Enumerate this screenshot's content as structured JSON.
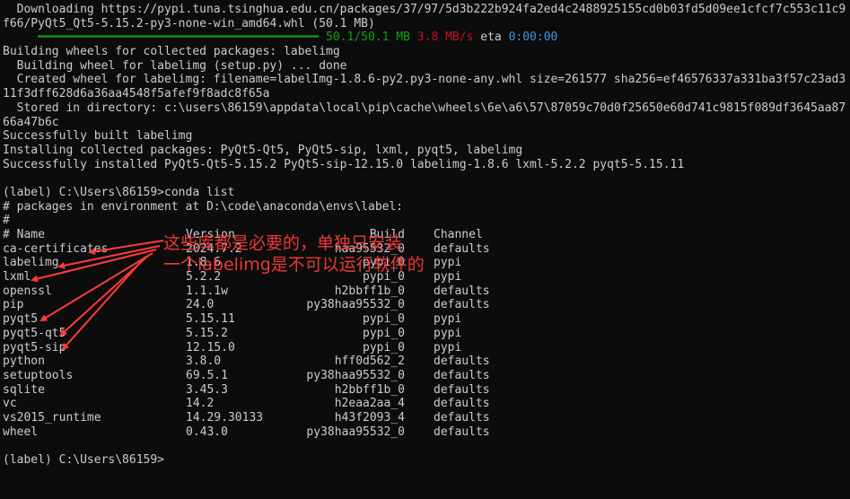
{
  "terminal": {
    "header_lines": [
      {
        "segments": [
          {
            "t": "  Downloading https://pypi.tuna.tsinghua.edu.cn/packages/37/97/5d3b222b924fa2ed4c2488925155cd0b03fd5d09ee1cfcf7c553c11c9"
          }
        ]
      },
      {
        "segments": [
          {
            "t": "f66/PyQt5_Qt5-5.15.2-py3-none-win_amd64.whl (50.1 MB)"
          }
        ]
      },
      {
        "segments": [
          {
            "t": "     ",
            "c": ""
          },
          {
            "t": "━━━━━━━━━━━━━━━━━━━━━━━━━━━━━━━━━━━━━━━━",
            "c": "seg-dashes"
          },
          {
            "t": " ",
            "c": ""
          },
          {
            "t": "50.1/50.1 MB",
            "c": "seg-green"
          },
          {
            "t": " ",
            "c": ""
          },
          {
            "t": "3.8 MB/s",
            "c": "seg-red"
          },
          {
            "t": " eta ",
            "c": ""
          },
          {
            "t": "0:00:00",
            "c": "seg-cyan"
          }
        ]
      },
      {
        "segments": [
          {
            "t": "Building wheels for collected packages: labelimg"
          }
        ]
      },
      {
        "segments": [
          {
            "t": "  Building wheel for labelimg (setup.py) ... done"
          }
        ]
      },
      {
        "segments": [
          {
            "t": "  Created wheel for labelimg: filename=labelImg-1.8.6-py2.py3-none-any.whl size=261577 sha256=ef46576337a331ba3f57c23ad3"
          }
        ]
      },
      {
        "segments": [
          {
            "t": "11f3dff628d6a36aa4548f5afef9f8adc8f65a"
          }
        ]
      },
      {
        "segments": [
          {
            "t": "  Stored in directory: c:\\users\\86159\\appdata\\local\\pip\\cache\\wheels\\6e\\a6\\57\\87059c70d0f25650e60d741c9815f089df3645aa87"
          }
        ]
      },
      {
        "segments": [
          {
            "t": "66a47b6c"
          }
        ]
      },
      {
        "segments": [
          {
            "t": "Successfully built labelimg"
          }
        ]
      },
      {
        "segments": [
          {
            "t": "Installing collected packages: PyQt5-Qt5, PyQt5-sip, lxml, pyqt5, labelimg"
          }
        ]
      },
      {
        "segments": [
          {
            "t": "Successfully installed PyQt5-Qt5-5.15.2 PyQt5-sip-12.15.0 labelimg-1.8.6 lxml-5.2.2 pyqt5-5.15.11"
          }
        ]
      },
      {
        "segments": [
          {
            "t": ""
          }
        ]
      },
      {
        "segments": [
          {
            "t": "(label) C:\\Users\\86159>conda list"
          }
        ]
      },
      {
        "segments": [
          {
            "t": "# packages in environment at D:\\code\\anaconda\\envs\\label:"
          }
        ]
      },
      {
        "segments": [
          {
            "t": "#"
          }
        ]
      }
    ],
    "table_header": {
      "name": "# Name",
      "version": "Version",
      "build": "Build",
      "channel": "Channel"
    },
    "packages": [
      {
        "name": "ca-certificates",
        "version": "2024.7.2",
        "build": "haa95532_0",
        "channel": "defaults"
      },
      {
        "name": "labelimg",
        "version": "1.8.6",
        "build": "pypi_0",
        "channel": "pypi"
      },
      {
        "name": "lxml",
        "version": "5.2.2",
        "build": "pypi_0",
        "channel": "pypi"
      },
      {
        "name": "openssl",
        "version": "1.1.1w",
        "build": "h2bbff1b_0",
        "channel": "defaults"
      },
      {
        "name": "pip",
        "version": "24.0",
        "build": "py38haa95532_0",
        "channel": "defaults"
      },
      {
        "name": "pyqt5",
        "version": "5.15.11",
        "build": "pypi_0",
        "channel": "pypi"
      },
      {
        "name": "pyqt5-qt5",
        "version": "5.15.2",
        "build": "pypi_0",
        "channel": "pypi"
      },
      {
        "name": "pyqt5-sip",
        "version": "12.15.0",
        "build": "pypi_0",
        "channel": "pypi"
      },
      {
        "name": "python",
        "version": "3.8.0",
        "build": "hff0d562_2",
        "channel": "defaults"
      },
      {
        "name": "setuptools",
        "version": "69.5.1",
        "build": "py38haa95532_0",
        "channel": "defaults"
      },
      {
        "name": "sqlite",
        "version": "3.45.3",
        "build": "h2bbff1b_0",
        "channel": "defaults"
      },
      {
        "name": "vc",
        "version": "14.2",
        "build": "h2eaa2aa_4",
        "channel": "defaults"
      },
      {
        "name": "vs2015_runtime",
        "version": "14.29.30133",
        "build": "h43f2093_4",
        "channel": "defaults"
      },
      {
        "name": "wheel",
        "version": "0.43.0",
        "build": "py38haa95532_0",
        "channel": "defaults"
      }
    ],
    "footer_blank": "",
    "prompt": "(label) C:\\Users\\86159>"
  },
  "annotation": {
    "line1": "这些库都是必要的，单独只安装",
    "line2": "一个labelimg是不可以运行软件的",
    "color": "#ff3b3b"
  },
  "colors": {
    "background": "#0c0c0c",
    "foreground": "#cccccc",
    "progress": "#13a10e",
    "speed": "#c50f1f",
    "eta": "#3a96dd"
  }
}
